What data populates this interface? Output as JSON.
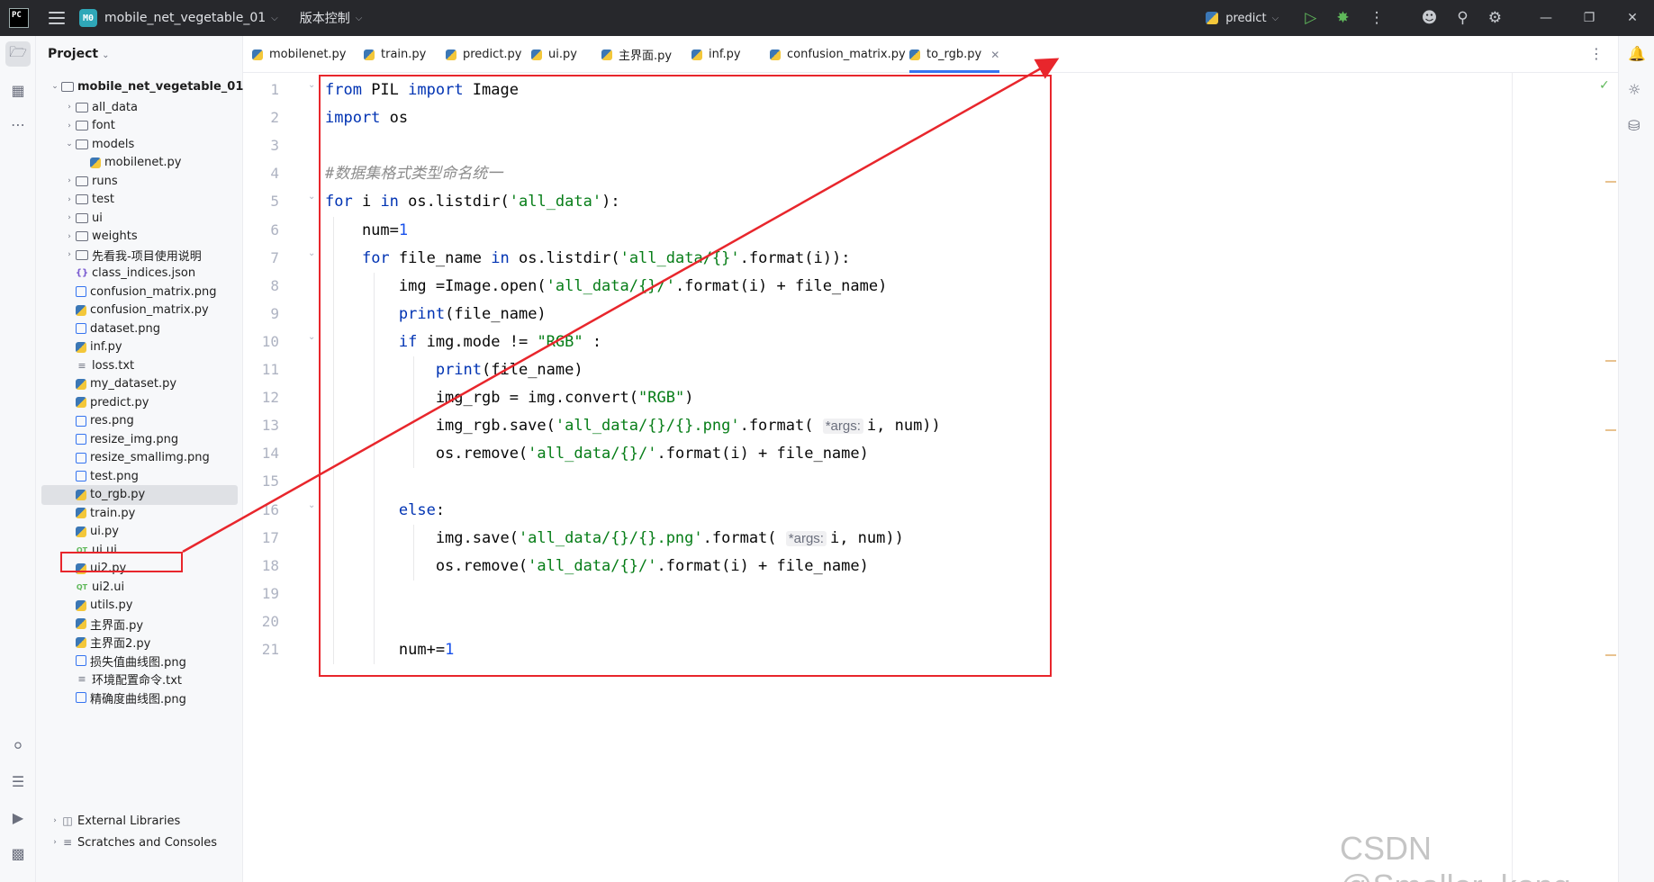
{
  "titlebar": {
    "app_logo": "PC",
    "project_badge": "M0",
    "project_name": "mobile_net_vegetable_01",
    "vcs_label": "版本控制",
    "run_config": "predict",
    "icons": [
      "run-icon",
      "debug-icon",
      "more-icon",
      "add-user-icon",
      "search-icon",
      "settings-icon"
    ],
    "window_buttons": [
      "minimize",
      "restore",
      "close"
    ]
  },
  "project_panel": {
    "header": "Project",
    "root": "mobile_net_vegetable_01",
    "items": [
      {
        "label": "all_data",
        "type": "folder",
        "depth": 1,
        "expanded": false
      },
      {
        "label": "font",
        "type": "folder",
        "depth": 1,
        "expanded": false
      },
      {
        "label": "models",
        "type": "folder",
        "depth": 1,
        "expanded": true
      },
      {
        "label": "mobilenet.py",
        "type": "py",
        "depth": 2
      },
      {
        "label": "runs",
        "type": "folder",
        "depth": 1,
        "expanded": false
      },
      {
        "label": "test",
        "type": "folder",
        "depth": 1,
        "expanded": false
      },
      {
        "label": "ui",
        "type": "folder",
        "depth": 1,
        "expanded": false
      },
      {
        "label": "weights",
        "type": "folder",
        "depth": 1,
        "expanded": false
      },
      {
        "label": "先看我-项目使用说明",
        "type": "folder",
        "depth": 1,
        "expanded": false
      },
      {
        "label": "class_indices.json",
        "type": "json",
        "depth": 1
      },
      {
        "label": "confusion_matrix.png",
        "type": "img",
        "depth": 1
      },
      {
        "label": "confusion_matrix.py",
        "type": "py",
        "depth": 1
      },
      {
        "label": "dataset.png",
        "type": "img",
        "depth": 1
      },
      {
        "label": "inf.py",
        "type": "py",
        "depth": 1
      },
      {
        "label": "loss.txt",
        "type": "txt",
        "depth": 1
      },
      {
        "label": "my_dataset.py",
        "type": "py",
        "depth": 1
      },
      {
        "label": "predict.py",
        "type": "py",
        "depth": 1
      },
      {
        "label": "res.png",
        "type": "img",
        "depth": 1
      },
      {
        "label": "resize_img.png",
        "type": "img",
        "depth": 1
      },
      {
        "label": "resize_smallimg.png",
        "type": "img",
        "depth": 1
      },
      {
        "label": "test.png",
        "type": "img",
        "depth": 1
      },
      {
        "label": "to_rgb.py",
        "type": "py",
        "depth": 1,
        "selected": true
      },
      {
        "label": "train.py",
        "type": "py",
        "depth": 1
      },
      {
        "label": "ui.py",
        "type": "py",
        "depth": 1
      },
      {
        "label": "ui.ui",
        "type": "qt",
        "depth": 1
      },
      {
        "label": "ui2.py",
        "type": "py",
        "depth": 1
      },
      {
        "label": "ui2.ui",
        "type": "qt",
        "depth": 1
      },
      {
        "label": "utils.py",
        "type": "py",
        "depth": 1
      },
      {
        "label": "主界面.py",
        "type": "py",
        "depth": 1
      },
      {
        "label": "主界面2.py",
        "type": "py",
        "depth": 1
      },
      {
        "label": "损失值曲线图.png",
        "type": "img",
        "depth": 1
      },
      {
        "label": "环境配置命令.txt",
        "type": "txt",
        "depth": 1
      },
      {
        "label": "精确度曲线图.png",
        "type": "img",
        "depth": 1
      }
    ],
    "external_libraries": "External Libraries",
    "scratches": "Scratches and Consoles"
  },
  "tabs": [
    {
      "label": "mobilenet.py",
      "active": false
    },
    {
      "label": "train.py",
      "active": false
    },
    {
      "label": "predict.py",
      "active": false
    },
    {
      "label": "ui.py",
      "active": false
    },
    {
      "label": "主界面.py",
      "active": false
    },
    {
      "label": "inf.py",
      "active": false
    },
    {
      "label": "confusion_matrix.py",
      "active": false
    },
    {
      "label": "to_rgb.py",
      "active": true
    }
  ],
  "editor": {
    "line_numbers": [
      "1",
      "2",
      "3",
      "4",
      "5",
      "6",
      "7",
      "8",
      "9",
      "10",
      "11",
      "12",
      "13",
      "14",
      "15",
      "16",
      "17",
      "18",
      "19",
      "20",
      "21"
    ],
    "lines": [
      [
        {
          "t": "kw",
          "v": "from"
        },
        {
          "t": "p",
          "v": " PIL "
        },
        {
          "t": "kw",
          "v": "import"
        },
        {
          "t": "p",
          "v": " Image"
        }
      ],
      [
        {
          "t": "kw",
          "v": "import"
        },
        {
          "t": "p",
          "v": " os"
        }
      ],
      [],
      [
        {
          "t": "cmt",
          "v": "#数据集格式类型命名统一"
        }
      ],
      [
        {
          "t": "kw",
          "v": "for"
        },
        {
          "t": "p",
          "v": " i "
        },
        {
          "t": "kw",
          "v": "in"
        },
        {
          "t": "p",
          "v": " os.listdir("
        },
        {
          "t": "str",
          "v": "'all_data'"
        },
        {
          "t": "p",
          "v": "):"
        }
      ],
      [
        {
          "t": "p",
          "v": "    num="
        },
        {
          "t": "num",
          "v": "1"
        }
      ],
      [
        {
          "t": "p",
          "v": "    "
        },
        {
          "t": "kw",
          "v": "for"
        },
        {
          "t": "p",
          "v": " file_name "
        },
        {
          "t": "kw",
          "v": "in"
        },
        {
          "t": "p",
          "v": " os.listdir("
        },
        {
          "t": "str",
          "v": "'all_data/{}'"
        },
        {
          "t": "p",
          "v": ".format(i)):"
        }
      ],
      [
        {
          "t": "p",
          "v": "        img =Image.open("
        },
        {
          "t": "str",
          "v": "'all_data/{}/'"
        },
        {
          "t": "p",
          "v": ".format(i) + file_name)"
        }
      ],
      [
        {
          "t": "p",
          "v": "        "
        },
        {
          "t": "kw",
          "v": "print"
        },
        {
          "t": "p",
          "v": "(file_name)"
        }
      ],
      [
        {
          "t": "p",
          "v": "        "
        },
        {
          "t": "kw",
          "v": "if"
        },
        {
          "t": "p",
          "v": " img.mode != "
        },
        {
          "t": "str",
          "v": "\"RGB\""
        },
        {
          "t": "p",
          "v": " :"
        }
      ],
      [
        {
          "t": "p",
          "v": "            "
        },
        {
          "t": "kw",
          "v": "print"
        },
        {
          "t": "p",
          "v": "(file_name)"
        }
      ],
      [
        {
          "t": "p",
          "v": "            img_rgb = img.convert("
        },
        {
          "t": "str",
          "v": "\"RGB\""
        },
        {
          "t": "p",
          "v": ")"
        }
      ],
      [
        {
          "t": "p",
          "v": "            img_rgb.save("
        },
        {
          "t": "str",
          "v": "'all_data/{}/{}.png'"
        },
        {
          "t": "p",
          "v": ".format( "
        },
        {
          "t": "hint",
          "v": "*args:"
        },
        {
          "t": "p",
          "v": "i, num))"
        }
      ],
      [
        {
          "t": "p",
          "v": "            os.remove("
        },
        {
          "t": "str",
          "v": "'all_data/{}/'"
        },
        {
          "t": "p",
          "v": ".format(i) + file_name)"
        }
      ],
      [],
      [
        {
          "t": "p",
          "v": "        "
        },
        {
          "t": "kw",
          "v": "else"
        },
        {
          "t": "p",
          "v": ":"
        }
      ],
      [
        {
          "t": "p",
          "v": "            img.save("
        },
        {
          "t": "str",
          "v": "'all_data/{}/{}.png'"
        },
        {
          "t": "p",
          "v": ".format( "
        },
        {
          "t": "hint",
          "v": "*args:"
        },
        {
          "t": "p",
          "v": "i, num))"
        }
      ],
      [
        {
          "t": "p",
          "v": "            os.remove("
        },
        {
          "t": "str",
          "v": "'all_data/{}/'"
        },
        {
          "t": "p",
          "v": ".format(i) + file_name)"
        }
      ],
      [],
      [],
      [
        {
          "t": "p",
          "v": "        num+="
        },
        {
          "t": "num",
          "v": "1"
        }
      ]
    ],
    "fold_lines": [
      1,
      5,
      7,
      10,
      16
    ]
  },
  "annotation": {
    "color": "#e8262c"
  },
  "watermark": "CSDN @Smaller_kong",
  "colors": {
    "accent": "#3574f0",
    "titlebar_bg": "#27282c",
    "keyword": "#0033b3",
    "string": "#067d17",
    "number": "#1750eb"
  }
}
